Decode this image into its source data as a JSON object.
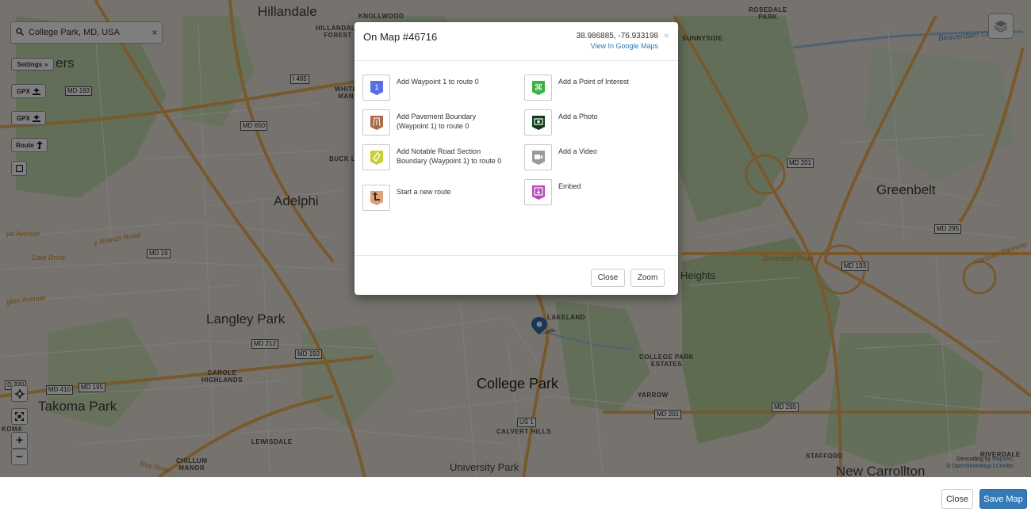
{
  "map": {
    "places": {
      "hillandale": "Hillandale",
      "knollwood": "KNOLLWOOD",
      "hillandale_forest_1": "HILLANDALE",
      "hillandale_forest_2": "FOREST",
      "rosedale_park_1": "ROSEDALE",
      "rosedale_park_2": "PARK",
      "sunnyside": "SUNNYSIDE",
      "adelphi": "Adelphi",
      "greenbelt": "Greenbelt",
      "langley_park": "Langley Park",
      "carole_highlands_1": "CAROLE",
      "carole_highlands_2": "HIGHLANDS",
      "college_park": "College Park",
      "lakeland": "LAKELAND",
      "college_park_estates_1": "COLLEGE PARK",
      "college_park_estates_2": "ESTATES",
      "yarrow": "YARROW",
      "takoma_park": "Takoma Park",
      "calvert_hills": "CALVERT HILLS",
      "lewisdale": "LEWISDALE",
      "chillum_manor_1": "CHILLUM",
      "chillum_manor_2": "MANOR",
      "university_park": "University Park",
      "stafford": "STAFFORD",
      "new_carrollton": "New Carrollton",
      "heights": "Heights",
      "white_man_1": "WHITE",
      "white_man_2": "MAN",
      "buck_l": "BUCK L",
      "riversdale": "RIVERDALE",
      "ers": "ers",
      "koma": "KOMA"
    },
    "shields": {
      "md193_top": "MD 193",
      "i495": "I 495",
      "md650": "MD 650",
      "md19": "MD 19",
      "md212": "MD 212",
      "md193_mid": "MD 193",
      "md410": "MD 410",
      "md195": "MD 195",
      "md320": "D 320",
      "us1": "US 1",
      "md201_a": "MD 201",
      "md201_b": "MD 201",
      "md295_a": "MD 295",
      "md295_b": "MD 295",
      "md193_right": "MD 193"
    },
    "road_labels": {
      "beaverdam": "Beaverdam Creek",
      "greenbelt_road": "Greenbelt Road",
      "hanover": "Hanover Parkway",
      "branch_road": "y Branch Road",
      "dale_drive": "Dale Drive",
      "gion_avenue": "gion Avenue",
      "ye_avenue": "ye Avenue",
      "roy_road": "Roy Road"
    },
    "attribution": {
      "geocoding_prefix": "Geocoding by",
      "mapzen": "Mapzen,",
      "copyright": "©",
      "osm": "OpenStreetMap",
      "separator": "|",
      "credits": "Credits"
    }
  },
  "controls": {
    "search": {
      "icon": "search-icon",
      "value": "College Park, MD, USA",
      "clear": "×"
    },
    "settings_label": "Settings",
    "settings_icon": "»",
    "gpx_upload_label": "GPX",
    "gpx_download_label": "GPX",
    "route_label": "Route",
    "zoom_in": "+",
    "zoom_out": "−"
  },
  "modal": {
    "title": "On Map #46716",
    "coords": "38.986885, -76.933198",
    "google_link": "View In Google Maps",
    "close_x": "×",
    "actions_left": [
      {
        "label": "Add Waypoint 1 to route 0",
        "icon": "waypoint-icon",
        "color": "#5a6ee8"
      },
      {
        "label": "Add Pavement Boundary (Waypoint 1) to route 0",
        "icon": "pavement-boundary-icon",
        "color": "#a66b4a"
      },
      {
        "label": "Add Notable Road Section Boundary (Waypoint 1) to route 0",
        "icon": "road-section-icon",
        "color": "#c9cf3a"
      },
      {
        "label": "Start a new route",
        "icon": "new-route-icon",
        "color": "#d9a27a"
      }
    ],
    "actions_right": [
      {
        "label": "Add a Point of Interest",
        "icon": "point-of-interest-icon",
        "color": "#3cb043"
      },
      {
        "label": "Add a Photo",
        "icon": "photo-icon",
        "color": "#0b3d1a"
      },
      {
        "label": "Add a Video",
        "icon": "video-icon",
        "color": "#9a9a9a"
      },
      {
        "label": "Embed",
        "icon": "embed-icon",
        "color": "#b847b5"
      }
    ],
    "waypoint_number": "1",
    "close_label": "Close",
    "zoom_label": "Zoom"
  },
  "footer": {
    "close_label": "Close",
    "save_label": "Save Map"
  }
}
